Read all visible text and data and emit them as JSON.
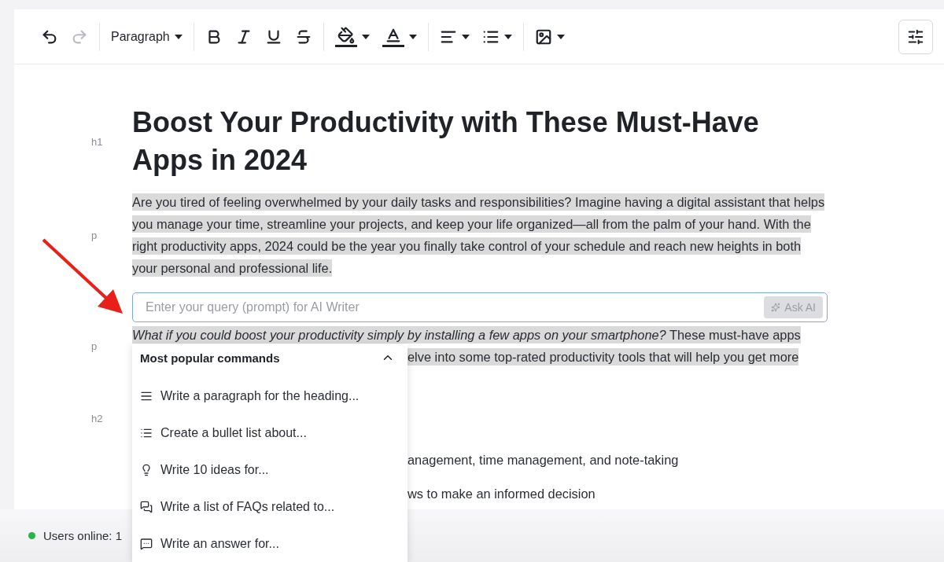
{
  "toolbar": {
    "groups": [
      {
        "tools": [
          {
            "kind": "button",
            "disabled": false
          },
          {
            "kind": "button",
            "disabled": true
          }
        ]
      },
      {
        "tools": [
          {
            "kind": "select",
            "label": "Paragraph"
          }
        ]
      },
      {
        "tools": [
          {
            "kind": "button"
          },
          {
            "kind": "button"
          },
          {
            "kind": "button"
          },
          {
            "kind": "button"
          }
        ]
      },
      {
        "tools": [
          {
            "kind": "menu-button"
          },
          {
            "kind": "menu-button"
          }
        ]
      },
      {
        "tools": [
          {
            "kind": "menu-button"
          },
          {
            "kind": "menu-button"
          }
        ]
      },
      {
        "tools": [
          {
            "kind": "menu-button"
          }
        ]
      }
    ]
  },
  "document": {
    "blocks": [
      {
        "kind": "heading",
        "tag": "h1",
        "text": "Boost Your Productivity with These Must-Have Apps in 2024"
      },
      {
        "kind": "paragraph",
        "tag": "p",
        "highlighted": true,
        "text": "Are you tired of feeling overwhelmed by your daily tasks and responsibilities? Imagine having a digital assistant that helps you manage your time, streamline your projects, and keep your life organized—all from the palm of your hand. With the right productivity apps, 2024 could be the year you finally take control of your schedule and reach new heights in both your personal and professional life."
      },
      {
        "kind": "prompt",
        "placeholder": "Enter your query (prompt) for AI Writer",
        "button": {
          "label": "Ask AI",
          "disabled": true
        }
      },
      {
        "kind": "partial",
        "tag": "p",
        "highlighted": true,
        "lines": [
          "*What if you could boost your productivity simply by installing a few apps on your smartphone?* These must-have apps"
        ],
        "cut_lines": [
          "elve into some top-rated productivity tools that will help you get more"
        ]
      },
      {
        "kind": "hidden-heading",
        "tag": "h2"
      },
      {
        "kind": "partial-list",
        "cut_lines": [
          "anagement, time management, and note-taking",
          "ws to make an informed decision"
        ]
      }
    ]
  },
  "commands_popup": {
    "title": "Most popular commands",
    "expanded": true,
    "items": [
      "Write a paragraph for the heading...",
      "Create a bullet list about...",
      "Write 10 ideas for...",
      "Write a list of FAQs related to...",
      "Write an answer for..."
    ]
  },
  "status_bar": {
    "text": "Users online: 1",
    "online": true
  }
}
